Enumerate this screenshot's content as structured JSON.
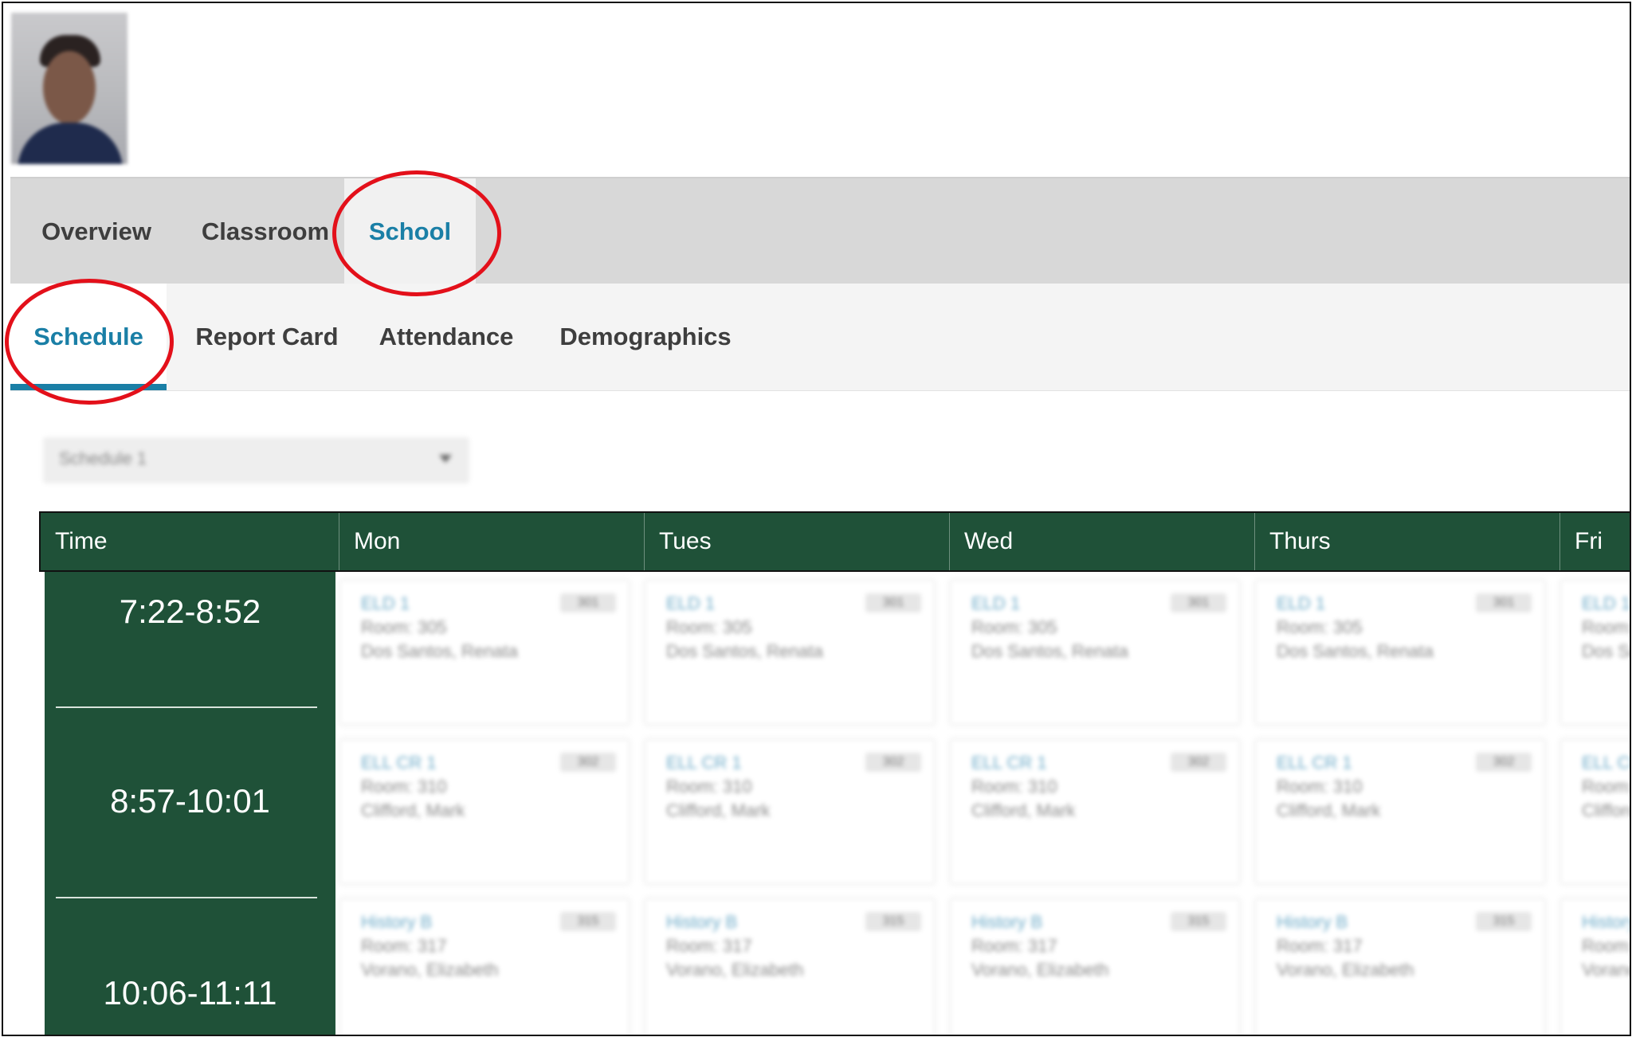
{
  "top_tabs": [
    {
      "label": "Overview",
      "active": false
    },
    {
      "label": "Classroom",
      "active": false
    },
    {
      "label": "School",
      "active": true
    }
  ],
  "sub_tabs": [
    {
      "label": "Schedule",
      "active": true
    },
    {
      "label": "Report Card",
      "active": false
    },
    {
      "label": "Attendance",
      "active": false
    },
    {
      "label": "Demographics",
      "active": false
    }
  ],
  "annotation_color": "#e3101a",
  "accent_color": "#1a7fa6",
  "schedule_header_color": "#1f5138",
  "schedule_select": {
    "value": "Schedule 1",
    "icon": "chevron-down-icon"
  },
  "schedule": {
    "columns": [
      "Time",
      "Mon",
      "Tues",
      "Wed",
      "Thurs",
      "Fri"
    ],
    "time_slots": [
      "7:22-8:52",
      "8:57-10:01",
      "10:06-11:11"
    ],
    "rows": [
      {
        "title": "ELD 1",
        "room": "Room: 305",
        "teacher": "Dos Santos, Renata",
        "badge": "301"
      },
      {
        "title": "ELL CR 1",
        "room": "Room: 310",
        "teacher": "Clifford, Mark",
        "badge": "302"
      },
      {
        "title": "History B",
        "room": "Room: 317",
        "teacher": "Vorano, Elizabeth",
        "badge": "315"
      }
    ]
  }
}
